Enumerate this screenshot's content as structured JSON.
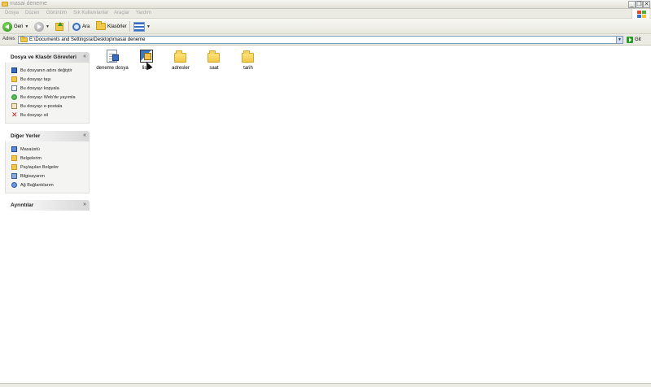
{
  "window": {
    "title": "masai deneme",
    "controls": {
      "minimize": "_",
      "restore": "❐",
      "close": "✕"
    }
  },
  "menubar": {
    "items": [
      "Dosya",
      "Düzen",
      "Görünüm",
      "Sık Kullanılanlar",
      "Araçlar",
      "Yardım"
    ]
  },
  "toolbar": {
    "back_label": "Geri",
    "search_label": "Ara",
    "folders_label": "Klasörler"
  },
  "address": {
    "label": "Adres",
    "path": "E:\\Documents and Settings\\a\\Desktop\\masai deneme",
    "go_label": "Git"
  },
  "taskpane": {
    "file_tasks": {
      "title": "Dosya ve Klasör Görevleri",
      "items": [
        {
          "label": "Bu dosyanın adını değiştir",
          "icon": "rename-icon"
        },
        {
          "label": "Bu dosyayı taşı",
          "icon": "move-icon"
        },
        {
          "label": "Bu dosyayı kopyala",
          "icon": "copy-icon"
        },
        {
          "label": "Bu dosyayı Web'de yayımla",
          "icon": "web-publish-icon"
        },
        {
          "label": "Bu dosyayı e-postala",
          "icon": "email-icon"
        },
        {
          "label": "Bu dosyayı sil",
          "icon": "delete-icon"
        }
      ]
    },
    "other_places": {
      "title": "Diğer Yerler",
      "items": [
        {
          "label": "Masaüstü",
          "icon": "desktop-icon"
        },
        {
          "label": "Belgelerim",
          "icon": "my-documents-icon"
        },
        {
          "label": "Paylaşılan Belgeler",
          "icon": "shared-documents-icon"
        },
        {
          "label": "Bilgisayarım",
          "icon": "my-computer-icon"
        },
        {
          "label": "Ağ Bağlantılarım",
          "icon": "network-icon"
        }
      ]
    },
    "details": {
      "title": "Ayrıntılar"
    }
  },
  "files": [
    {
      "name": "deneme dosya",
      "type": "document"
    },
    {
      "name": "liste",
      "type": "application"
    },
    {
      "name": "adresler",
      "type": "folder"
    },
    {
      "name": "saat",
      "type": "folder"
    },
    {
      "name": "tarih",
      "type": "folder"
    }
  ],
  "colors": {
    "folder": "#f0c94b",
    "accent_blue": "#3a6cc2",
    "delete_red": "#cc2222"
  }
}
